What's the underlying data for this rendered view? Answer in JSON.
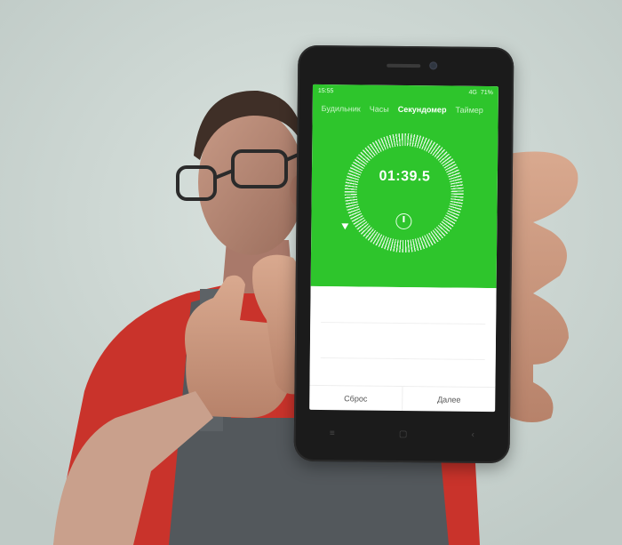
{
  "status_bar": {
    "time": "15:55",
    "battery": "71%",
    "network": "4G"
  },
  "tabs": [
    {
      "label": "Будильник",
      "active": false
    },
    {
      "label": "Часы",
      "active": false
    },
    {
      "label": "Секундомер",
      "active": true
    },
    {
      "label": "Таймер",
      "active": false
    }
  ],
  "stopwatch": {
    "elapsed": "01:39.5"
  },
  "buttons": {
    "reset": "Сброс",
    "next": "Далее"
  },
  "icons": {
    "accent_color": "#2ec52c",
    "nav": [
      "menu-icon",
      "home-icon",
      "back-icon"
    ]
  }
}
